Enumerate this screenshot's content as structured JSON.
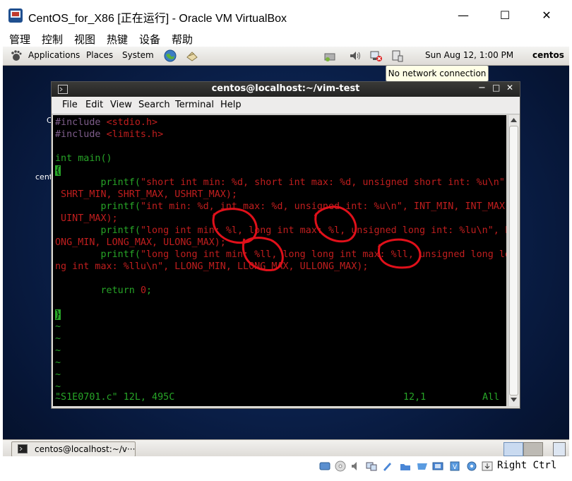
{
  "window": {
    "title": "CentOS_for_X86 [正在运行] - Oracle VM VirtualBox",
    "minimize_glyph": "—",
    "maximize_glyph": "☐",
    "close_glyph": "✕"
  },
  "vbox_menu": [
    "管理",
    "控制",
    "视图",
    "热键",
    "设备",
    "帮助"
  ],
  "gnome_panel": {
    "menus": [
      "Applications",
      "Places",
      "System"
    ],
    "clock": "Sun Aug 12,  1:00 PM",
    "user": "centos",
    "tooltip": "No network connection"
  },
  "terminal": {
    "title": "centos@localhost:~/vim-test",
    "menu": [
      "File",
      "Edit",
      "View",
      "Search",
      "Terminal",
      "Help"
    ],
    "title_buttons": [
      "−",
      "□",
      "✕"
    ]
  },
  "vim": {
    "lines": [
      [
        {
          "t": "#include ",
          "c": "pp"
        },
        {
          "t": "<stdio.h>",
          "c": "str"
        }
      ],
      [
        {
          "t": "#include ",
          "c": "pp"
        },
        {
          "t": "<limits.h>",
          "c": "str"
        }
      ],
      [],
      [
        {
          "t": "int",
          "c": "kw"
        },
        {
          "t": " main()",
          "c": "tx"
        }
      ],
      [
        {
          "t": "{",
          "c": "cursor"
        }
      ],
      [
        {
          "t": "        printf(",
          "c": "tx"
        },
        {
          "t": "\"short int min: %d, short int max: %d, unsigned short int: %u\\n\"",
          "c": "str"
        },
        {
          "t": ",",
          "c": "tx"
        }
      ],
      [
        {
          "t": " SHRT_MIN, SHRT_MAX, USHRT_MAX);",
          "c": "str"
        }
      ],
      [
        {
          "t": "        printf(",
          "c": "tx"
        },
        {
          "t": "\"int min: %d, int max: %d, unsigned int: %u\\n\"",
          "c": "str"
        },
        {
          "t": ", INT_MIN, INT_MAX,",
          "c": "str"
        }
      ],
      [
        {
          "t": " UINT_MAX);",
          "c": "str"
        }
      ],
      [
        {
          "t": "        printf(",
          "c": "tx"
        },
        {
          "t": "\"long int min: %l, long int max: %l, unsigned long int: %lu\\n\"",
          "c": "str"
        },
        {
          "t": ", L",
          "c": "str"
        }
      ],
      [
        {
          "t": "ONG_MIN, LONG_MAX, ULONG_MAX);",
          "c": "str"
        }
      ],
      [
        {
          "t": "        printf(",
          "c": "tx"
        },
        {
          "t": "\"long long int min: %ll, long long int max: %ll, unsigned long lo",
          "c": "str"
        }
      ],
      [
        {
          "t": "ng int max: %llu\\n\", LLONG_MIN, LLONG_MAX, ULLONG_MAX);",
          "c": "str"
        }
      ],
      [],
      [
        {
          "t": "        return ",
          "c": "tx"
        },
        {
          "t": "0",
          "c": "str"
        },
        {
          "t": ";",
          "c": "tx"
        }
      ],
      [],
      [
        {
          "t": "}",
          "c": "cursor"
        }
      ],
      [
        {
          "t": "~",
          "c": "tilde"
        }
      ],
      [
        {
          "t": "~",
          "c": "tilde"
        }
      ],
      [
        {
          "t": "~",
          "c": "tilde"
        }
      ],
      [
        {
          "t": "~",
          "c": "tilde"
        }
      ],
      [
        {
          "t": "~",
          "c": "tilde"
        }
      ],
      [
        {
          "t": "~",
          "c": "tilde"
        }
      ],
      [
        {
          "t": "~",
          "c": "tilde"
        }
      ]
    ],
    "status_file": "\"S1E0701.c\" 12L, 495C",
    "status_pos": "12,1",
    "status_scroll": "All"
  },
  "taskbar": {
    "task_label": "centos@localhost:~/v···"
  },
  "statusbar": {
    "host_key": "Right Ctrl"
  },
  "colors": {
    "vim_green": "#27a427",
    "vim_red": "#c01e1e",
    "vim_purple": "#7e5d8b",
    "annotation_red": "#e0101a"
  }
}
